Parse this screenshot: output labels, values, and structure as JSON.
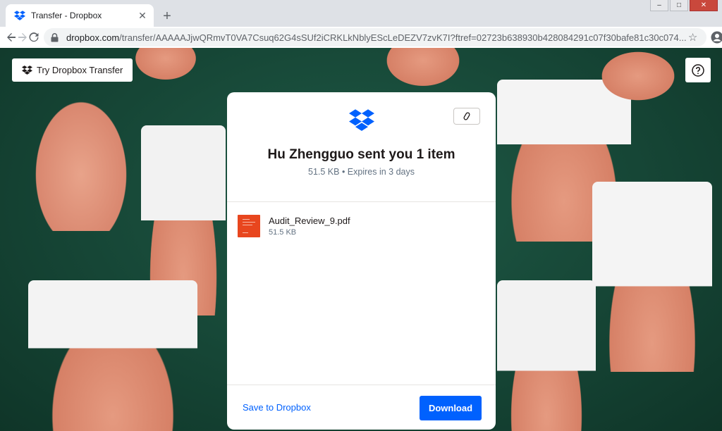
{
  "browser": {
    "tab_title": "Transfer - Dropbox",
    "url_host": "dropbox.com",
    "url_path": "/transfer/AAAAAJjwQRmvT0VA7Csuq62G4sSUf2iCRKLkNblyEScLeDEZV7zvK7I?ftref=02723b638930b428084291c07f30bafe81c30c074..."
  },
  "page": {
    "try_button_label": "Try Dropbox Transfer",
    "help_icon": "question-circle-icon"
  },
  "card": {
    "title": "Hu Zhengguo sent you 1 item",
    "subtitle": "51.5 KB • Expires in 3 days",
    "files": [
      {
        "name": "Audit_Review_9.pdf",
        "size": "51.5 KB"
      }
    ],
    "save_label": "Save to Dropbox",
    "download_label": "Download"
  },
  "colors": {
    "accent": "#0061fe",
    "background": "#164636",
    "file_icon": "#e8461e"
  }
}
